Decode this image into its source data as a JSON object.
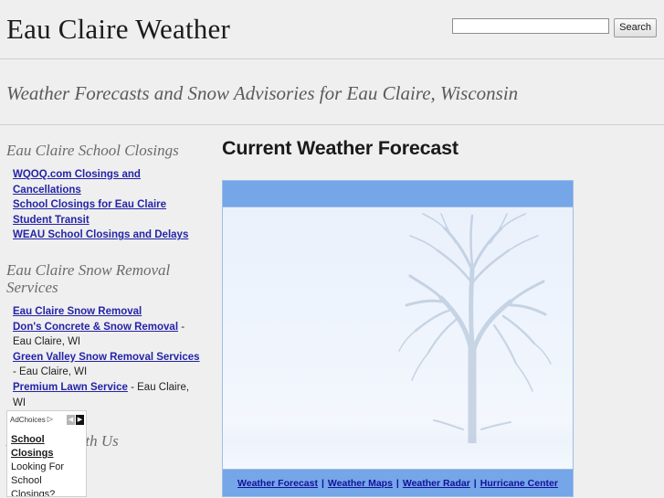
{
  "header": {
    "site_title": "Eau Claire Weather",
    "search": {
      "value": "",
      "placeholder": "",
      "button_label": "Search"
    }
  },
  "tagline": "Weather Forecasts and Snow Advisories for Eau Claire, Wisconsin",
  "sidebar": {
    "school_closings": {
      "heading": "Eau Claire School Closings",
      "links": [
        "WQOQ.com Closings and Cancellations",
        "School Closings for Eau Claire",
        "Student Transit",
        "WEAU School Closings and Delays"
      ]
    },
    "snow_removal": {
      "heading": "Eau Claire Snow Removal Services",
      "items": [
        {
          "link": "Eau Claire Snow Removal",
          "suffix": ""
        },
        {
          "link": "Don's Concrete & Snow Removal",
          "suffix": " - Eau Claire, WI"
        },
        {
          "link": "Green Valley Snow Removal Services",
          "suffix": " - Eau Claire, WI"
        },
        {
          "link": "Premium Lawn Service",
          "suffix": " - Eau Claire, WI"
        }
      ]
    },
    "advertise": {
      "heading": "Advertise With Us"
    },
    "ad_box": {
      "adchoices_label": "AdChoices",
      "adchoices_icon": "triangle-right-icon",
      "prev_arrow": "◀",
      "next_arrow": "▶",
      "title": "School Closings",
      "lines": [
        "Looking For",
        "School Closings?"
      ]
    }
  },
  "main": {
    "title": "Current Weather Forecast",
    "weather_widget": {
      "image_alt": "snow-covered-tree-in-fog",
      "footer_links": [
        "Weather Forecast",
        "Weather Maps",
        "Weather Radar",
        "Hurricane Center"
      ],
      "footer_separator": "|"
    }
  },
  "colors": {
    "page_background": "#efefef",
    "link_blue": "#2424a8",
    "widget_blue": "#74a6e8",
    "widget_border": "#9ebde8",
    "widget_scene": "#eef4fd",
    "footer_link": "#121299",
    "heading_gray": "#6b6b6b",
    "separator": "#cfcfcf"
  }
}
